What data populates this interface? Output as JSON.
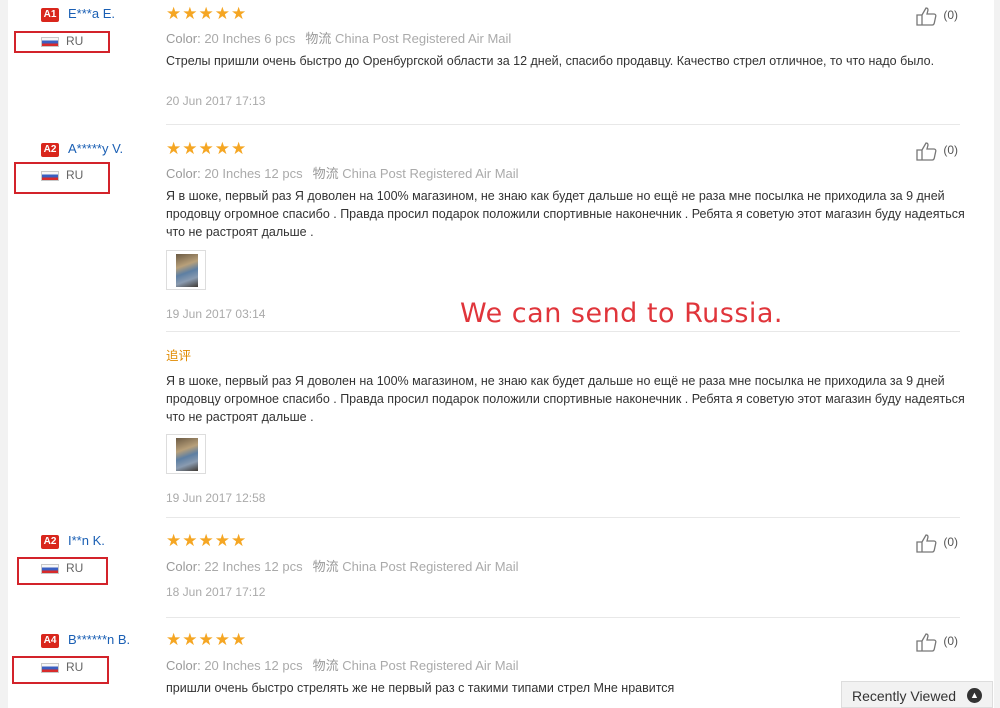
{
  "watermark": "We can send to Russia.",
  "recently_viewed": {
    "label": "Recently Viewed"
  },
  "labels": {
    "color": "Color:",
    "shipping_prefix": "物流",
    "followup": "追评"
  },
  "reviews": [
    {
      "level": "A1",
      "name": "E***a E.",
      "country": "RU",
      "rating": 5,
      "stars": "★★★★★",
      "color": "20 Inches 6 pcs",
      "shipping": "China Post Registered Air Mail",
      "text": "Стрелы пришли очень быстро до Оренбургской области за 12 дней, спасибо продавцу. Качество стрел отличное, то что надо было.",
      "date": "20 Jun 2017 17:13",
      "likes": "(0)"
    },
    {
      "level": "A2",
      "name": "A*****y V.",
      "country": "RU",
      "rating": 5,
      "stars": "★★★★★",
      "color": "20 Inches 12 pcs",
      "shipping": "China Post Registered Air Mail",
      "text": "Я в шоке, первый раз Я доволен на 100% магазином, не знаю как будет дальше но ещё не раза мне посылка не приходила за 9 дней продовцу огромное спасибо . Правда просил подарок положили спортивные наконечник . Ребята я советую этот магазин буду надеяться что не растроят дальше .",
      "date": "19 Jun 2017 03:14",
      "likes": "(0)",
      "followup_text": "Я в шоке, первый раз Я доволен на 100% магазином, не знаю как будет дальше но ещё не раза мне посылка не приходила за 9 дней продовцу огромное спасибо . Правда просил подарок положили спортивные наконечник . Ребята я советую этот магазин буду надеяться что не растроят дальше .",
      "followup_date": "19 Jun 2017 12:58"
    },
    {
      "level": "A2",
      "name": "I**n K.",
      "country": "RU",
      "rating": 5,
      "stars": "★★★★★",
      "color": "22 Inches 12 pcs",
      "shipping": "China Post Registered Air Mail",
      "date": "18 Jun 2017 17:12",
      "likes": "(0)"
    },
    {
      "level": "A4",
      "name": "B******n B.",
      "country": "RU",
      "rating": 5,
      "stars": "★★★★★",
      "color": "20 Inches 12 pcs",
      "shipping": "China Post Registered Air Mail",
      "text": "пришли очень быстро стрелять же не первый раз с такими типами стрел Мне нравится",
      "likes": "(0)"
    }
  ]
}
